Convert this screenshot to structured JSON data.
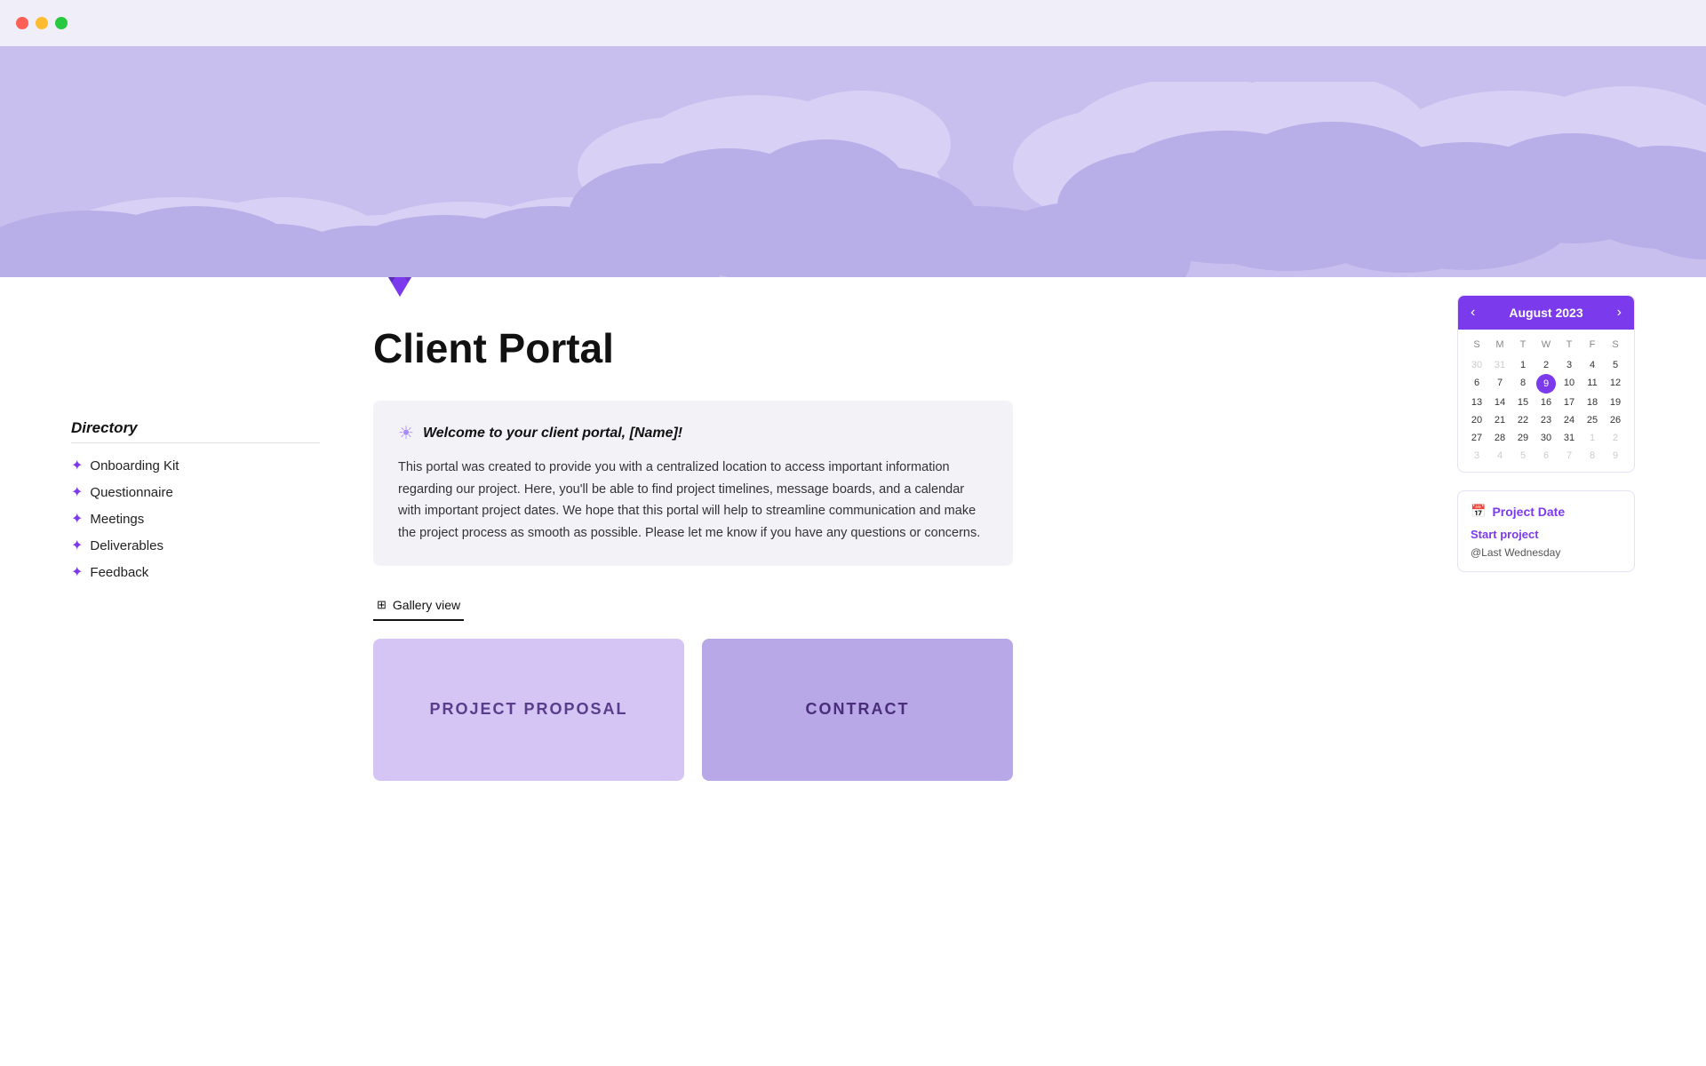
{
  "titlebar": {
    "dots": [
      "red",
      "yellow",
      "green"
    ]
  },
  "hero": {
    "bg_color": "#c8bfee"
  },
  "diamond": {
    "label": "diamond-gem-icon"
  },
  "page_title": "Client Portal",
  "welcome": {
    "icon": "☀",
    "title": "Welcome to your client portal, [Name]!",
    "body": "This portal was created to provide you with a centralized location to access important information regarding our project. Here, you'll be able to find project timelines, message boards, and a calendar with important project dates. We hope that this portal will help to streamline communication and make the project process as smooth as possible. Please let me know if you have any questions or concerns."
  },
  "gallery_tab": {
    "label": "Gallery view"
  },
  "gallery_cards": [
    {
      "label": "PROJECT PROPOSAL",
      "style": "proposal"
    },
    {
      "label": "CONTRACT",
      "style": "contract"
    }
  ],
  "sidebar": {
    "title": "Directory",
    "items": [
      {
        "label": "Onboarding Kit"
      },
      {
        "label": "Questionnaire"
      },
      {
        "label": "Meetings"
      },
      {
        "label": "Deliverables"
      },
      {
        "label": "Feedback"
      }
    ]
  },
  "calendar": {
    "title": "August 2023",
    "prev_label": "‹",
    "next_label": "›",
    "day_headers": [
      "S",
      "M",
      "T",
      "W",
      "T",
      "F",
      "S"
    ],
    "rows": [
      [
        "30",
        "31",
        "1",
        "2",
        "3",
        "4",
        "5"
      ],
      [
        "6",
        "7",
        "8",
        "9",
        "10",
        "11",
        "12"
      ],
      [
        "13",
        "14",
        "15",
        "16",
        "17",
        "18",
        "19"
      ],
      [
        "20",
        "21",
        "22",
        "23",
        "24",
        "25",
        "26"
      ],
      [
        "27",
        "28",
        "29",
        "30",
        "31",
        "1",
        "2"
      ],
      [
        "3",
        "4",
        "5",
        "6",
        "7",
        "8",
        "9"
      ]
    ],
    "today_row": 1,
    "today_col": 3,
    "other_month_cells": [
      [
        0,
        0
      ],
      [
        0,
        1
      ],
      [
        4,
        5
      ],
      [
        4,
        6
      ],
      [
        5,
        0
      ],
      [
        5,
        1
      ],
      [
        5,
        2
      ],
      [
        5,
        3
      ],
      [
        5,
        4
      ],
      [
        5,
        5
      ],
      [
        5,
        6
      ]
    ]
  },
  "project_date": {
    "title": "Project Date",
    "sub_label": "Start project",
    "value_label": "@Last Wednesday"
  }
}
